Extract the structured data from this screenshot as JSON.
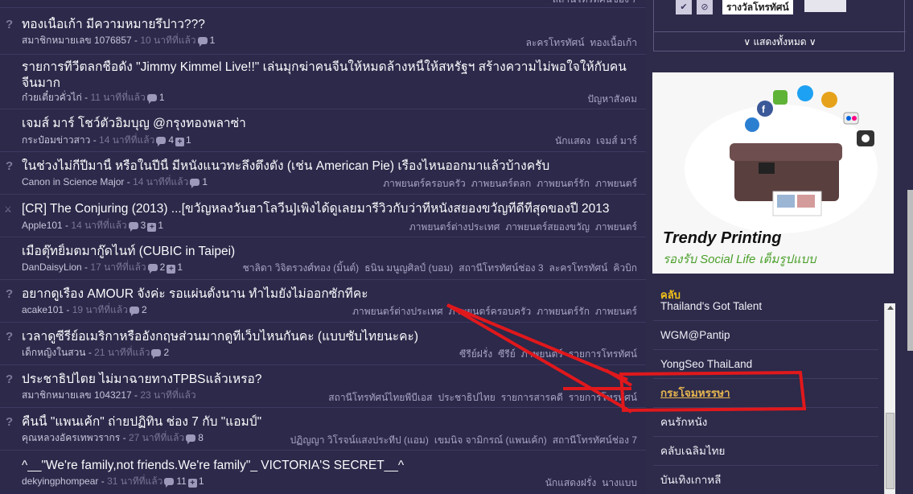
{
  "feed": {
    "rows": [
      {
        "title": "ทองเนื้อเก้า มีความหมายรึปาว???",
        "author": "สมาชิกหมายเลข 1076857",
        "time": "10 นาทีที่แล้ว",
        "comments": "1",
        "votes": "",
        "tags": [
          "ละครโทรทัศน์",
          "ทองเนื้อเก้า"
        ]
      },
      {
        "title": "รายการทีวีตลกชื่อดัง \"Jimmy Kimmel Live!!\" เล่นมุกฆ่าคนจีนให้หมดล้างหนี้ให้สหรัฐฯ สร้างความไม่พอใจให้กับคนจีนมาก",
        "author": "ก๋วยเตี๋ยวคั่วไก่",
        "time": "11 นาทีที่แล้ว",
        "comments": "1",
        "votes": "",
        "tags": [
          "ปัญหาสังคม"
        ]
      },
      {
        "title": "เจมส์ มาร์ โชว์ตัวอิ่มบุญ @กรุงทองพลาซ่า",
        "author": "กระป๋อมข่าวสาว",
        "time": "14 นาทีที่แล้ว",
        "comments": "4",
        "votes": "1",
        "tags": [
          "นักแสดง",
          "เจมส์ มาร์"
        ]
      },
      {
        "title": "ในช่วงไม่กี่ปีมานี้ หรือในปีนี้ มีหนังแนวทะลึ่งตึงตัง (เช่น American Pie) เรื่องไหนออกมาแล้วบ้างครับ",
        "author": "Canon in Science Major",
        "time": "14 นาทีที่แล้ว",
        "comments": "1",
        "votes": "",
        "tags": [
          "ภาพยนตร์ครอบครัว",
          "ภาพยนตร์ตลก",
          "ภาพยนตร์รัก",
          "ภาพยนตร์"
        ]
      },
      {
        "title": "[CR] The Conjuring (2013) ...[ขวัญหลงวันฮาโลวีน]เพิ่งได้ดูเลยมารีวิวกับว่าที่หนังสยองขวัญที่ดีที่สุดของปี 2013",
        "author": "Apple101",
        "time": "14 นาทีที่แล้ว",
        "comments": "3",
        "votes": "1",
        "tags": [
          "ภาพยนตร์ต่างประเทศ",
          "ภาพยนตร์สยองขวัญ",
          "ภาพยนตร์"
        ]
      },
      {
        "title": "เมื่อตุ๊ทยิ้มตมากู๊ดไนท์ (CUBIC in Taipei)",
        "author": "DanDaisyLion",
        "time": "17 นาทีที่แล้ว",
        "comments": "2",
        "votes": "1",
        "tags": [
          "ชาลิดา วิจิตรวงศ์ทอง (มิ้นต์)",
          "ธนิน มนูญศิลป์ (บอม)",
          "สถานีโทรทัศน์ช่อง 3",
          "ละครโทรทัศน์",
          "คิวบิก"
        ]
      },
      {
        "title": "อยากดูเรื่อง AMOUR จังค่ะ รอแผ่นตั้งนาน ทำไมยังไม่ออกซักทีคะ",
        "author": "acake101",
        "time": "19 นาทีที่แล้ว",
        "comments": "2",
        "votes": "",
        "tags": [
          "ภาพยนตร์ต่างประเทศ",
          "ภาพยนตร์ครอบครัว",
          "ภาพยนตร์รัก",
          "ภาพยนตร์"
        ]
      },
      {
        "title": "เวลาดูซีรี่ย์อเมริกาหรืออังกฤษส่วนมากดูที่เว็บไหนกันคะ (แบบซับไทยนะคะ)",
        "author": "เด็กหญิงในสวน",
        "time": "21 นาทีที่แล้ว",
        "comments": "2",
        "votes": "",
        "tags": [
          "ซีรีย์ฝรั่ง",
          "ซีรีย์",
          "ภาพยนตร์",
          "รายการโทรทัศน์"
        ]
      },
      {
        "title": "ประชาธิปไตย ไม่มาฉายทางTPBSแล้วเหรอ?",
        "author": "สมาชิกหมายเลข 1043217",
        "time": "23 นาทีที่แล้ว",
        "comments": "",
        "votes": "",
        "tags": [
          "สถานีโทรทัศน์ไทยพีบีเอส",
          "ประชาธิปไทย",
          "รายการสารคดี",
          "รายการโทรทัศน์"
        ]
      },
      {
        "title": "คืนนี้ \"แพนเค้ก\" ถ่ายปฏิทิน ช่อง 7 กับ \"แอมป์\"",
        "author": "คุณหลวงอัครเทพวรากร",
        "time": "27 นาทีที่แล้ว",
        "comments": "8",
        "votes": "",
        "tags": [
          "ปฏิญญา วิโรจน์แสงประทีป (แอม)",
          "เขมนิจ จามิกรณ์ (แพนเค้ก)",
          "สถานีโทรทัศน์ช่อง 7"
        ]
      },
      {
        "title": "^__\"We're family,not friends.We're family\"_ VICTORIA'S SECRET__^",
        "author": "dekyingphompear",
        "time": "31 นาทีที่แล้ว",
        "comments": "11",
        "votes": "1",
        "tags": [
          "นักแสดงฝรั่ง",
          "นางแบบ"
        ]
      }
    ]
  },
  "sidebar": {
    "top_tag": {
      "name": "รางวัลโทรทัศน์",
      "check_icon": "check-icon",
      "block_icon": "block-icon"
    },
    "show_all": "∨ แสดงทั้งหมด ∨",
    "ad": {
      "line1": "Trendy Printing",
      "line2": "รองรับ Social Life เต็มรูปแบบ"
    },
    "club_heading": "คลับ",
    "clubs": [
      "Thailand's Got Talent",
      "WGM@Pantip",
      "YongSeo ThaiLand",
      "กระโจมหรรษา",
      "คนรักหนัง",
      "คลับเฉลิมไทย",
      "บันเทิงเกาหลี"
    ]
  },
  "colors": {
    "background": "#2c294a",
    "link": "#e5b64f",
    "annotation": "#e0181c",
    "club_heading": "#f2c21a"
  }
}
